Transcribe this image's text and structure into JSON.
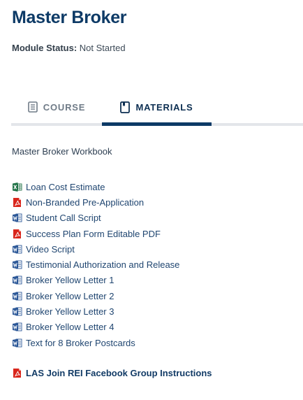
{
  "module": {
    "title": "Master Broker",
    "status_label": "Module Status:",
    "status_value": "Not Started"
  },
  "tabs": [
    {
      "label": "COURSE",
      "icon": "document-icon",
      "active": false
    },
    {
      "label": "MATERIALS",
      "icon": "bookmark-icon",
      "active": true
    }
  ],
  "colors": {
    "brand": "#0d3a66",
    "tab_rail": "#e3e6ea",
    "excel": "#1e7145",
    "pdf": "#d9261c",
    "word": "#2b5797"
  },
  "materials": {
    "workbook": "Master Broker Workbook",
    "files": [
      {
        "label": "Loan Cost Estimate",
        "type": "excel"
      },
      {
        "label": "Non-Branded Pre-Application",
        "type": "pdf"
      },
      {
        "label": "Student Call Script",
        "type": "word"
      },
      {
        "label": "Success Plan Form Editable PDF",
        "type": "pdf"
      },
      {
        "label": "Video Script",
        "type": "word"
      },
      {
        "label": "Testimonial Authorization and Release",
        "type": "word"
      },
      {
        "label": "Broker Yellow Letter 1",
        "type": "word"
      },
      {
        "label": "Broker Yellow Letter 2",
        "type": "word"
      },
      {
        "label": "Broker Yellow Letter 3",
        "type": "word"
      },
      {
        "label": "Broker Yellow Letter 4",
        "type": "word"
      },
      {
        "label": "Text for 8 Broker Postcards",
        "type": "word"
      }
    ],
    "facebook_link": {
      "label": "LAS Join REI Facebook Group Instructions",
      "type": "pdf"
    }
  }
}
